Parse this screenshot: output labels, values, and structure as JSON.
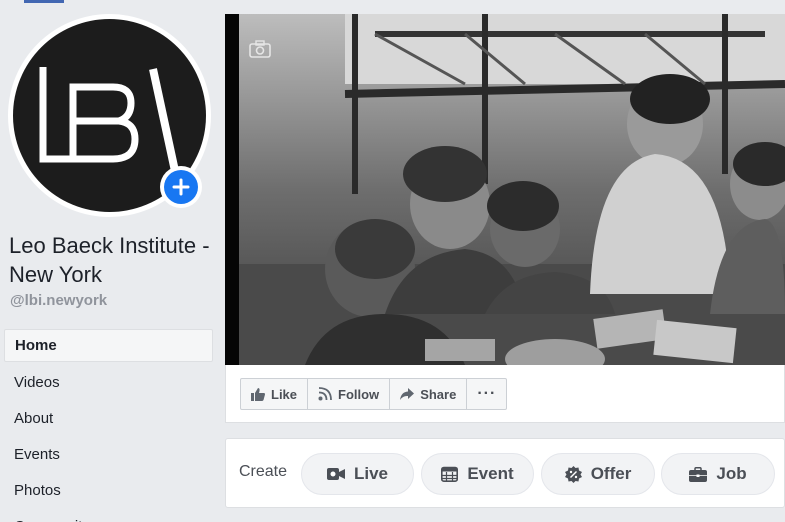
{
  "page": {
    "name": "Leo Baeck Institute - New York",
    "handle": "@lbi.newyork",
    "logo_text": "LBI"
  },
  "nav": {
    "items": [
      {
        "label": "Home",
        "active": true
      },
      {
        "label": "Videos"
      },
      {
        "label": "About"
      },
      {
        "label": "Events"
      },
      {
        "label": "Photos"
      },
      {
        "label": "Community"
      }
    ]
  },
  "actions": {
    "like": "Like",
    "follow": "Follow",
    "share": "Share",
    "more": "···"
  },
  "create": {
    "label": "Create",
    "live": "Live",
    "event": "Event",
    "offer": "Offer",
    "job": "Job"
  },
  "colors": {
    "accent": "#1877f2",
    "background": "#e9ebee",
    "logo_bg": "#1c1c1c"
  },
  "icons": [
    "plus-icon",
    "camera-icon",
    "like-icon",
    "follow-icon",
    "share-icon",
    "more-icon",
    "video-icon",
    "calendar-icon",
    "offer-icon",
    "briefcase-icon"
  ]
}
